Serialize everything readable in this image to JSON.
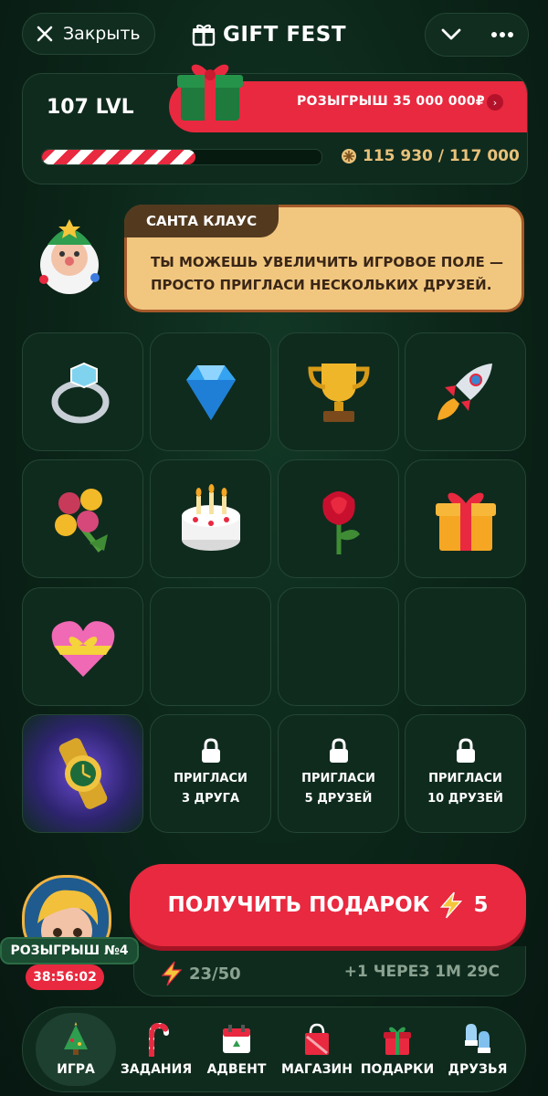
{
  "header": {
    "close_label": "Закрыть",
    "brand": "GIFT FEST",
    "icons": [
      "close-icon",
      "gift-logo-icon",
      "chevron-down-icon",
      "more-dots-icon"
    ]
  },
  "level": {
    "label": "107 LVL",
    "prize_text": "РОЗЫГРЫШ 35 000 000₽",
    "progress_fraction": 0.55,
    "score": "115 930 / 117 000"
  },
  "santa": {
    "speaker": "САНТА КЛАУС",
    "message": "ТЫ МОЖЕШЬ УВЕЛИЧИТЬ ИГРОВОЕ ПОЛЕ — ПРОСТО ПРИГЛАСИ НЕСКОЛЬКИХ ДРУЗЕЙ."
  },
  "grid": {
    "items": [
      "ring-icon",
      "diamond-icon",
      "trophy-icon",
      "rocket-icon",
      "bouquet-icon",
      "cake-icon",
      "rose-icon",
      "gift-box-icon",
      "heart-gift-icon",
      "empty",
      "empty",
      "empty",
      "watch-icon",
      "lock",
      "lock",
      "lock"
    ],
    "locks": [
      {
        "line1": "ПРИГЛАСИ",
        "line2": "3 ДРУГА"
      },
      {
        "line1": "ПРИГЛАСИ",
        "line2": "5 ДРУЗЕЙ"
      },
      {
        "line1": "ПРИГЛАСИ",
        "line2": "10 ДРУЗЕЙ"
      }
    ]
  },
  "claim": {
    "label": "ПОЛУЧИТЬ ПОДАРОК",
    "cost": "5",
    "energy": "23/50",
    "next_energy": "+1 ЧЕРЕЗ 1М 29С"
  },
  "draw": {
    "label": "РОЗЫГРЫШ №4",
    "timer": "38:56:02"
  },
  "nav": {
    "items": [
      {
        "label": "ИГРА",
        "icon": "christmas-tree-icon",
        "active": true
      },
      {
        "label": "ЗАДАНИЯ",
        "icon": "candy-cane-icon"
      },
      {
        "label": "АДВЕНТ",
        "icon": "calendar-icon"
      },
      {
        "label": "МАГАЗИН",
        "icon": "shopping-bag-icon"
      },
      {
        "label": "ПОДАРКИ",
        "icon": "gift-icon"
      },
      {
        "label": "ДРУЗЬЯ",
        "icon": "mittens-icon"
      }
    ]
  },
  "colors": {
    "background": "#0b2418",
    "accent_red": "#e8293f",
    "gold": "#e9c17a",
    "speech_bg": "#f1c77f"
  }
}
